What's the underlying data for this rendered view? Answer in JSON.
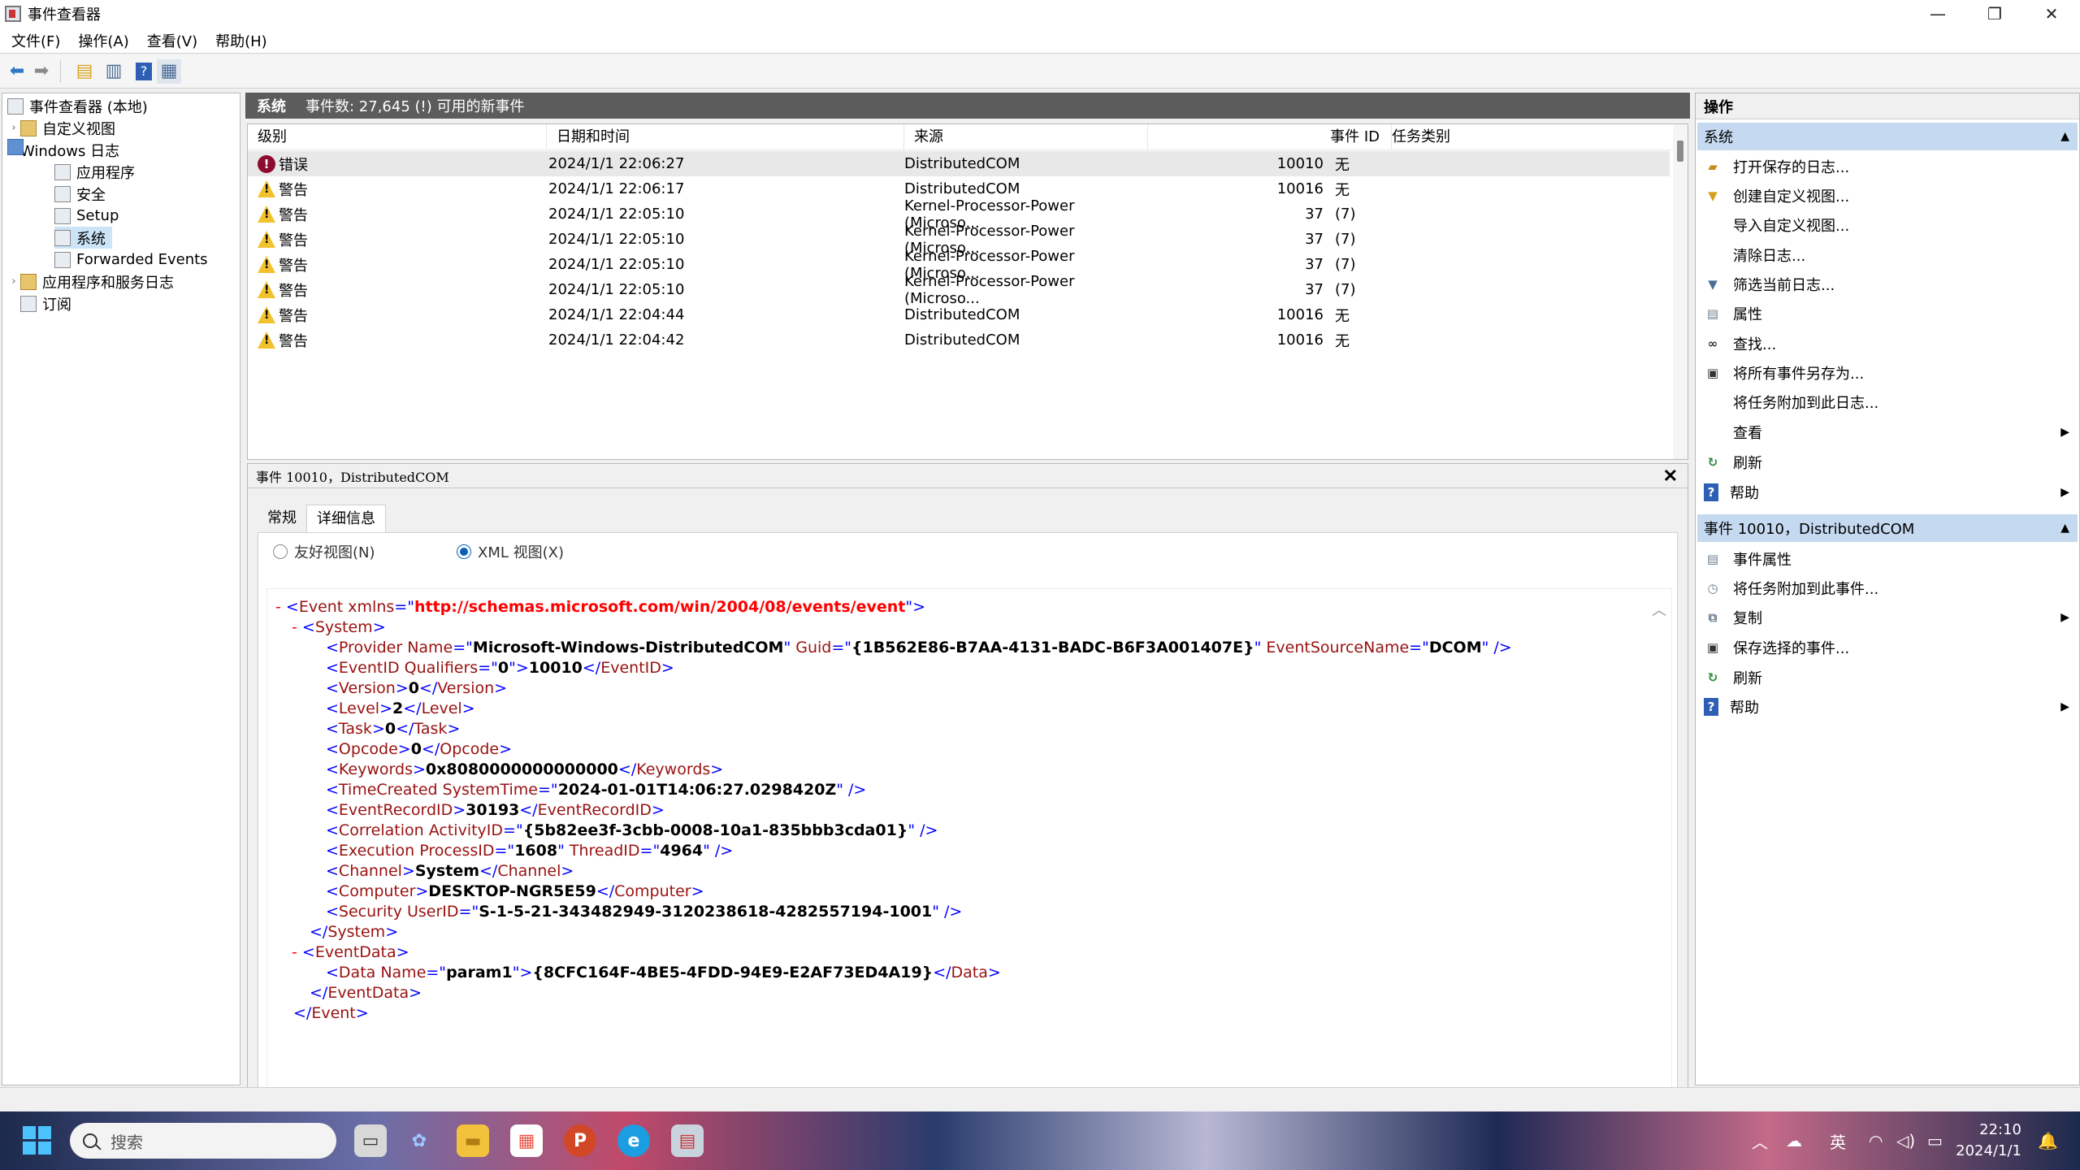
{
  "window": {
    "title": "事件查看器",
    "minimize": "—",
    "restore": "❐",
    "close": "✕"
  },
  "menu": [
    "文件(F)",
    "操作(A)",
    "查看(V)",
    "帮助(H)"
  ],
  "tree": {
    "root": "事件查看器 (本地)",
    "custom": "自定义视图",
    "winlogs": "Windows 日志",
    "app": "应用程序",
    "security": "安全",
    "setup": "Setup",
    "system": "系统",
    "forwarded": "Forwarded Events",
    "appsvc": "应用程序和服务日志",
    "subs": "订阅"
  },
  "events_header": {
    "log": "系统",
    "count": "事件数: 27,645 (!) 可用的新事件"
  },
  "columns": [
    "级别",
    "日期和时间",
    "来源",
    "事件 ID",
    "任务类别"
  ],
  "rows": [
    {
      "level": "错误",
      "date": "2024/1/1 22:06:27",
      "source": "DistributedCOM",
      "id": "10010",
      "task": "无",
      "type": "error"
    },
    {
      "level": "警告",
      "date": "2024/1/1 22:06:17",
      "source": "DistributedCOM",
      "id": "10016",
      "task": "无",
      "type": "warning"
    },
    {
      "level": "警告",
      "date": "2024/1/1 22:05:10",
      "source": "Kernel-Processor-Power (Microso...",
      "id": "37",
      "task": "(7)",
      "type": "warning"
    },
    {
      "level": "警告",
      "date": "2024/1/1 22:05:10",
      "source": "Kernel-Processor-Power (Microso...",
      "id": "37",
      "task": "(7)",
      "type": "warning"
    },
    {
      "level": "警告",
      "date": "2024/1/1 22:05:10",
      "source": "Kernel-Processor-Power (Microso...",
      "id": "37",
      "task": "(7)",
      "type": "warning"
    },
    {
      "level": "警告",
      "date": "2024/1/1 22:05:10",
      "source": "Kernel-Processor-Power (Microso...",
      "id": "37",
      "task": "(7)",
      "type": "warning"
    },
    {
      "level": "警告",
      "date": "2024/1/1 22:04:44",
      "source": "DistributedCOM",
      "id": "10016",
      "task": "无",
      "type": "warning"
    },
    {
      "level": "警告",
      "date": "2024/1/1 22:04:42",
      "source": "DistributedCOM",
      "id": "10016",
      "task": "无",
      "type": "warning"
    }
  ],
  "detail": {
    "title": "事件 10010，DistributedCOM",
    "close": "✕",
    "tabs": [
      "常规",
      "详细信息"
    ],
    "radio_friendly": "友好视图(N)",
    "radio_xml": "XML 视图(X)"
  },
  "xml": {
    "collapse": "-",
    "event_ns_attr": "Event xmlns",
    "event_ns": "http://schemas.microsoft.com/win/2004/08/events/event",
    "provider_name": "Microsoft-Windows-DistributedCOM",
    "provider_guid": "{1B562E86-B7AA-4131-BADC-B6F3A001407E}",
    "event_source": "DCOM",
    "qualifiers": "0",
    "event_id": "10010",
    "version": "0",
    "level": "2",
    "task": "0",
    "opcode": "0",
    "keywords": "0x8080000000000000",
    "time_created": "2024-01-01T14:06:27.0298420Z",
    "record_id": "30193",
    "activity_id": "{5b82ee3f-3cbb-0008-10a1-835bbb3cda01}",
    "process_id": "1608",
    "thread_id": "4964",
    "channel": "System",
    "computer": "DESKTOP-NGR5E59",
    "user_id": "S-1-5-21-343482949-3120238618-4282557194-1001",
    "param_name": "param1",
    "param_value": "{8CFC164F-4BE5-4FDD-94E9-E2AF73ED4A19}"
  },
  "actions": {
    "header": "操作",
    "section1": "系统",
    "items1": [
      "打开保存的日志...",
      "创建自定义视图...",
      "导入自定义视图...",
      "清除日志...",
      "筛选当前日志...",
      "属性",
      "查找...",
      "将所有事件另存为...",
      "将任务附加到此日志...",
      "查看",
      "刷新",
      "帮助"
    ],
    "section2": "事件 10010，DistributedCOM",
    "items2": [
      "事件属性",
      "将任务附加到此事件...",
      "复制",
      "保存选择的事件...",
      "刷新",
      "帮助"
    ]
  },
  "taskbar": {
    "search_placeholder": "搜索",
    "ime": "英",
    "time": "22:10",
    "date": "2024/1/1"
  },
  "colors": {
    "selected_row": "#e8e8e8",
    "pane_header": "#5c5c5c",
    "action_section": "#c5d9f1",
    "xml_markup": "#0000ff",
    "xml_attr": "#ff0000",
    "xml_tag": "#991111"
  }
}
